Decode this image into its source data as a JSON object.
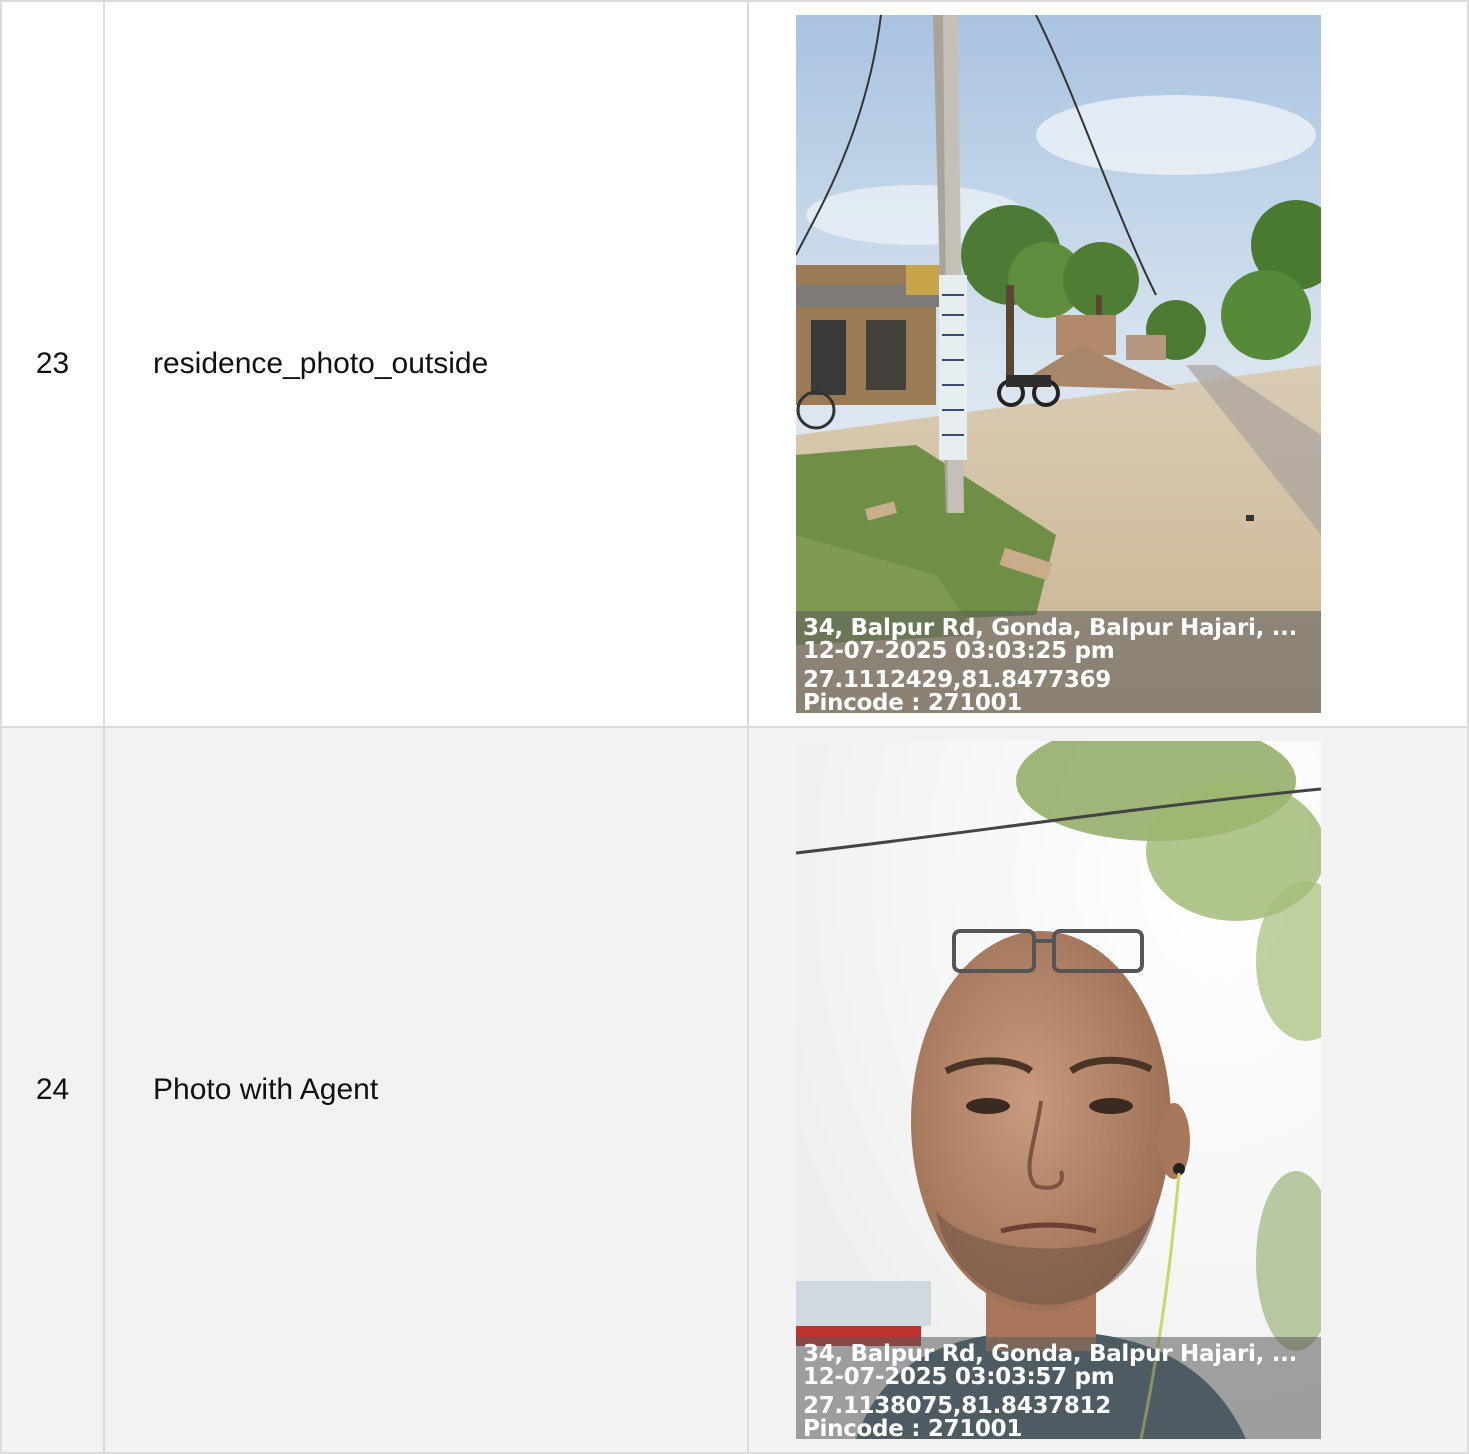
{
  "rows": [
    {
      "number": "23",
      "label": "residence_photo_outside",
      "photo": {
        "subject": "street-scene",
        "stamp": {
          "address": "34, Balpur Rd, Gonda, Balpur Hajari, ...",
          "datetime": "12-07-2025 03:03:25 pm",
          "coordinates": "27.1112429,81.8477369",
          "pincode": "Pincode : 271001"
        }
      }
    },
    {
      "number": "24",
      "label": "Photo with Agent",
      "photo": {
        "subject": "agent-selfie",
        "stamp": {
          "address": "34, Balpur Rd, Gonda, Balpur Hajari, ...",
          "datetime": "12-07-2025 03:03:57 pm",
          "coordinates": "27.1138075,81.8437812",
          "pincode": "Pincode : 271001"
        }
      }
    }
  ],
  "colors": {
    "border": "#dcdcdc",
    "row_alt_background": "#f2f2f2",
    "stamp_text": "#ffffff"
  }
}
